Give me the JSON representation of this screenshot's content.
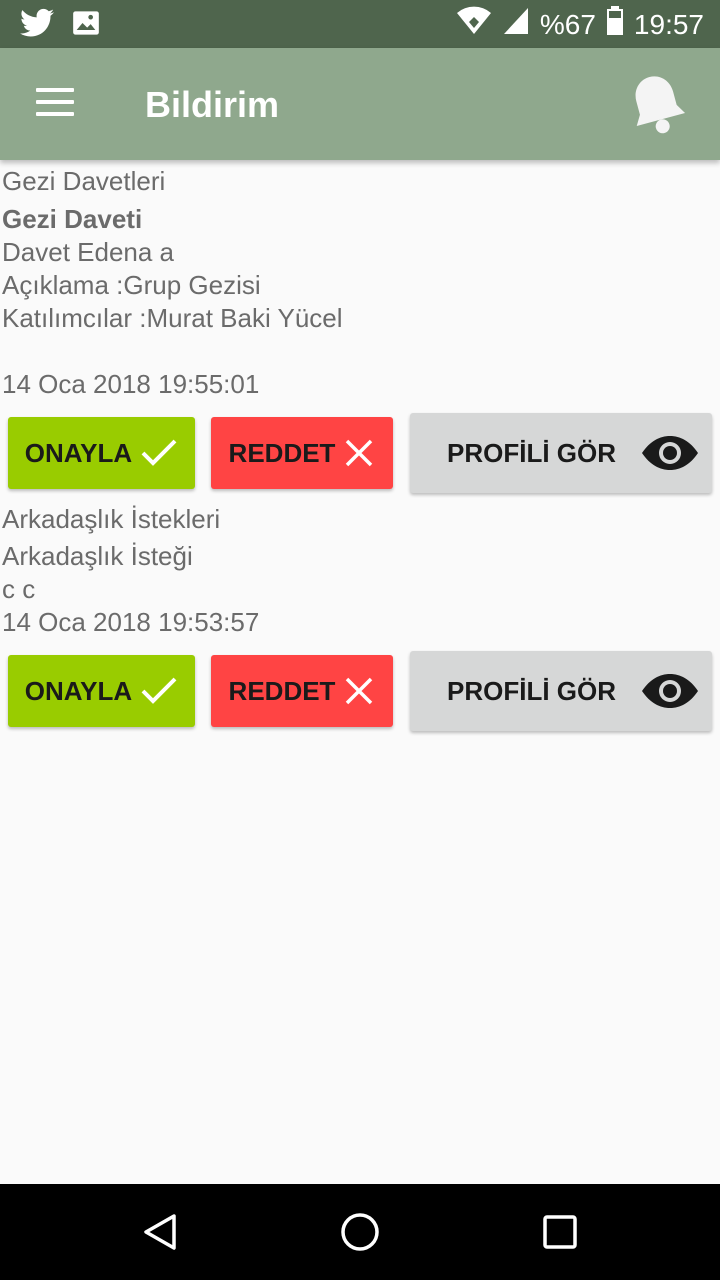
{
  "status_bar": {
    "battery": "%67",
    "time": "19:57",
    "icons": [
      "twitter-icon",
      "image-icon",
      "wifi-icon",
      "signal-icon",
      "battery-icon"
    ]
  },
  "app_bar": {
    "title": "Bildirim",
    "icons": [
      "menu-icon",
      "bell-icon"
    ]
  },
  "sections": [
    {
      "header": "Gezi Davetleri",
      "item_title": "Gezi Daveti",
      "lines": [
        "Davet Edena a",
        "Açıklama :Grup Gezisi",
        "Katılımcılar :Murat Baki Yücel"
      ],
      "timestamp": "14 Oca 2018 19:55:01",
      "approve_label": "ONAYLA",
      "reject_label": "REDDET",
      "profile_label": "PROFİLİ GÖR"
    },
    {
      "header": "Arkadaşlık İstekleri",
      "item_title": "Arkadaşlık İsteği",
      "lines": [
        "c c"
      ],
      "timestamp": "14 Oca 2018 19:53:57",
      "approve_label": "ONAYLA",
      "reject_label": "REDDET",
      "profile_label": "PROFİLİ GÖR"
    }
  ],
  "colors": {
    "status_bar": "#4f654d",
    "app_bar": "#8fa88d",
    "approve": "#99cc00",
    "reject": "#ff4444",
    "profile": "#d6d7d7"
  }
}
